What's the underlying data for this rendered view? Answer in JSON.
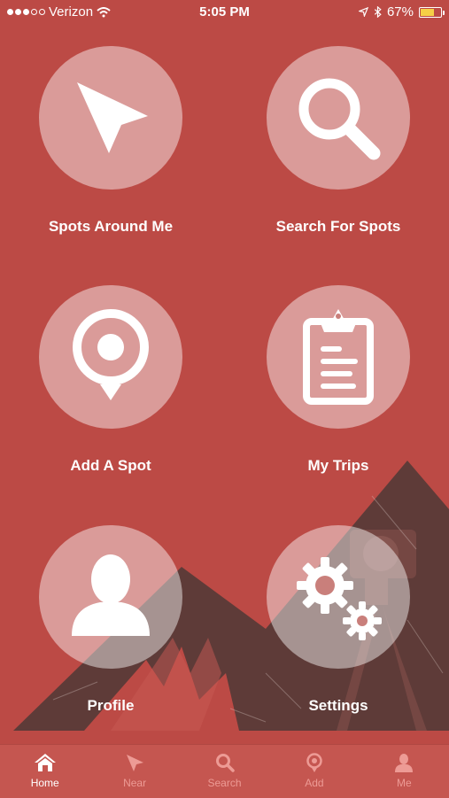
{
  "status": {
    "carrier": "Verizon",
    "time": "5:05 PM",
    "battery": "67%",
    "battery_level": 0.67,
    "signal_bars": 3
  },
  "menu": {
    "spots_around_me": "Spots Around Me",
    "search_for_spots": "Search For Spots",
    "add_a_spot": "Add A Spot",
    "my_trips": "My Trips",
    "profile": "Profile",
    "settings": "Settings"
  },
  "tabs": {
    "home": "Home",
    "near": "Near",
    "search": "Search",
    "add": "Add",
    "me": "Me",
    "active": "home"
  },
  "colors": {
    "background": "#bc4a45",
    "tab_bar": "#c55650",
    "active_tab": "#ffffff",
    "inactive_tab": "#ed9b95",
    "mountain": "#5e3b38"
  }
}
